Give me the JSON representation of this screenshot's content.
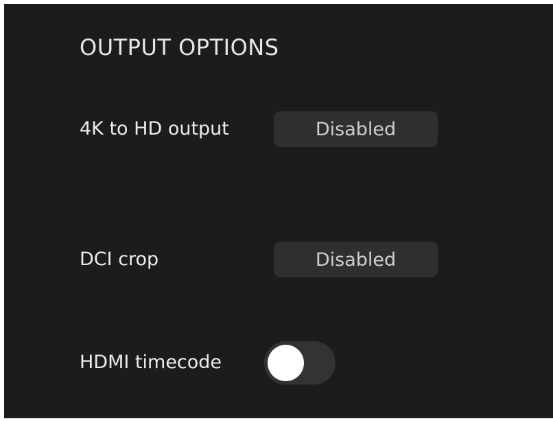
{
  "section": {
    "title": "OUTPUT OPTIONS"
  },
  "rows": {
    "four_k_to_hd": {
      "label": "4K to HD output",
      "value": "Disabled"
    },
    "dci_crop": {
      "label": "DCI crop",
      "value": "Disabled"
    },
    "hdmi_timecode": {
      "label": "HDMI timecode",
      "toggle_on": false
    }
  },
  "colors": {
    "panel_background": "#1c1c1c",
    "button_background": "#2f2f2f",
    "toggle_track": "#333333",
    "toggle_knob": "#ffffff",
    "label_text": "#ececec"
  }
}
